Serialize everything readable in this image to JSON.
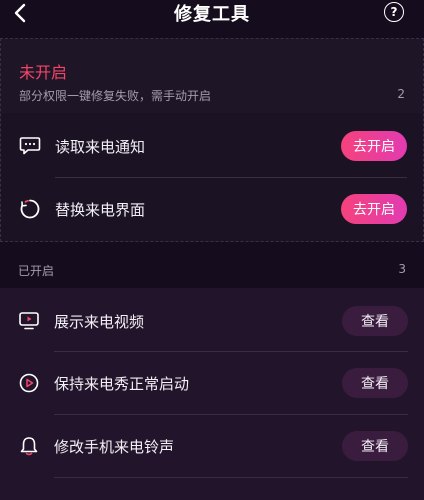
{
  "header": {
    "title": "修复工具",
    "back_icon": "chevron-left-icon",
    "help_label": "?"
  },
  "disabled_section": {
    "title": "未开启",
    "description": "部分权限一键修复失败，需手动开启",
    "count": "2",
    "items": [
      {
        "label": "读取来电通知",
        "icon": "chat-bubble-icon",
        "button": "去开启"
      },
      {
        "label": "替换来电界面",
        "icon": "refresh-icon",
        "button": "去开启"
      }
    ]
  },
  "enabled_section": {
    "title": "已开启",
    "count": "3",
    "items": [
      {
        "label": "展示来电视频",
        "icon": "monitor-icon",
        "button": "查看"
      },
      {
        "label": "保持来电秀正常启动",
        "icon": "play-circle-icon",
        "button": "查看"
      },
      {
        "label": "修改手机来电铃声",
        "icon": "bell-icon",
        "button": "查看"
      }
    ]
  },
  "colors": {
    "accent_red": "#f0466a",
    "button_gradient_start": "#f5427c",
    "button_gradient_end": "#e23bb2",
    "view_button_bg": "#3a1c3f",
    "background": "#150d1d"
  }
}
